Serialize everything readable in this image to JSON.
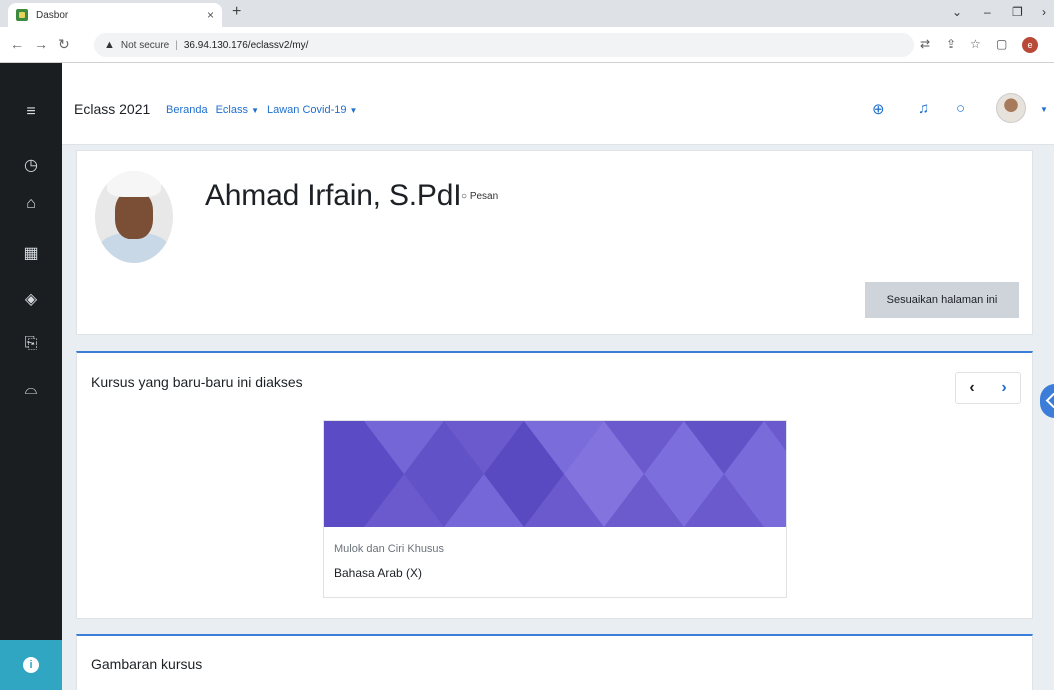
{
  "browser": {
    "tab_title": "Dasbor",
    "tab_close": "×",
    "new_tab": "+",
    "security_label": "Not secure",
    "url": "36.94.130.176/eclassv2/my/",
    "profile_initial": "e"
  },
  "navbar": {
    "brand": "Eclass 2021",
    "links": [
      {
        "label": "Beranda",
        "has_caret": false
      },
      {
        "label": "Eclass",
        "has_caret": true
      },
      {
        "label": "Lawan Covid-19",
        "has_caret": true
      }
    ],
    "icons": [
      "globe-icon",
      "bell-icon",
      "chat-icon"
    ]
  },
  "drawer": {
    "icons": [
      "menu-icon",
      "dashboard-icon",
      "home-icon",
      "calendar-icon",
      "layers-icon",
      "files-icon",
      "graduation-cap-icon"
    ],
    "bottom_icon": "info-icon"
  },
  "profile": {
    "full_name": "Ahmad Irfain, S.PdI",
    "message_label": "Pesan",
    "customize_label": "Sesuaikan halaman ini"
  },
  "recent_courses": {
    "title": "Kursus yang baru-baru ini diakses",
    "prev_label": "‹",
    "next_label": "›",
    "courses": [
      {
        "category": "Mulok dan Ciri Khusus",
        "name": "Bahasa Arab (X)",
        "image_color": "#6a5acd"
      }
    ]
  },
  "overview": {
    "title": "Gambaran kursus"
  },
  "colors": {
    "accent": "#3b7dd8",
    "link": "#1f6fcf",
    "drawer": "#1a1e21",
    "drawer_bottom": "#31a6c2",
    "button_secondary": "#ced4da"
  }
}
